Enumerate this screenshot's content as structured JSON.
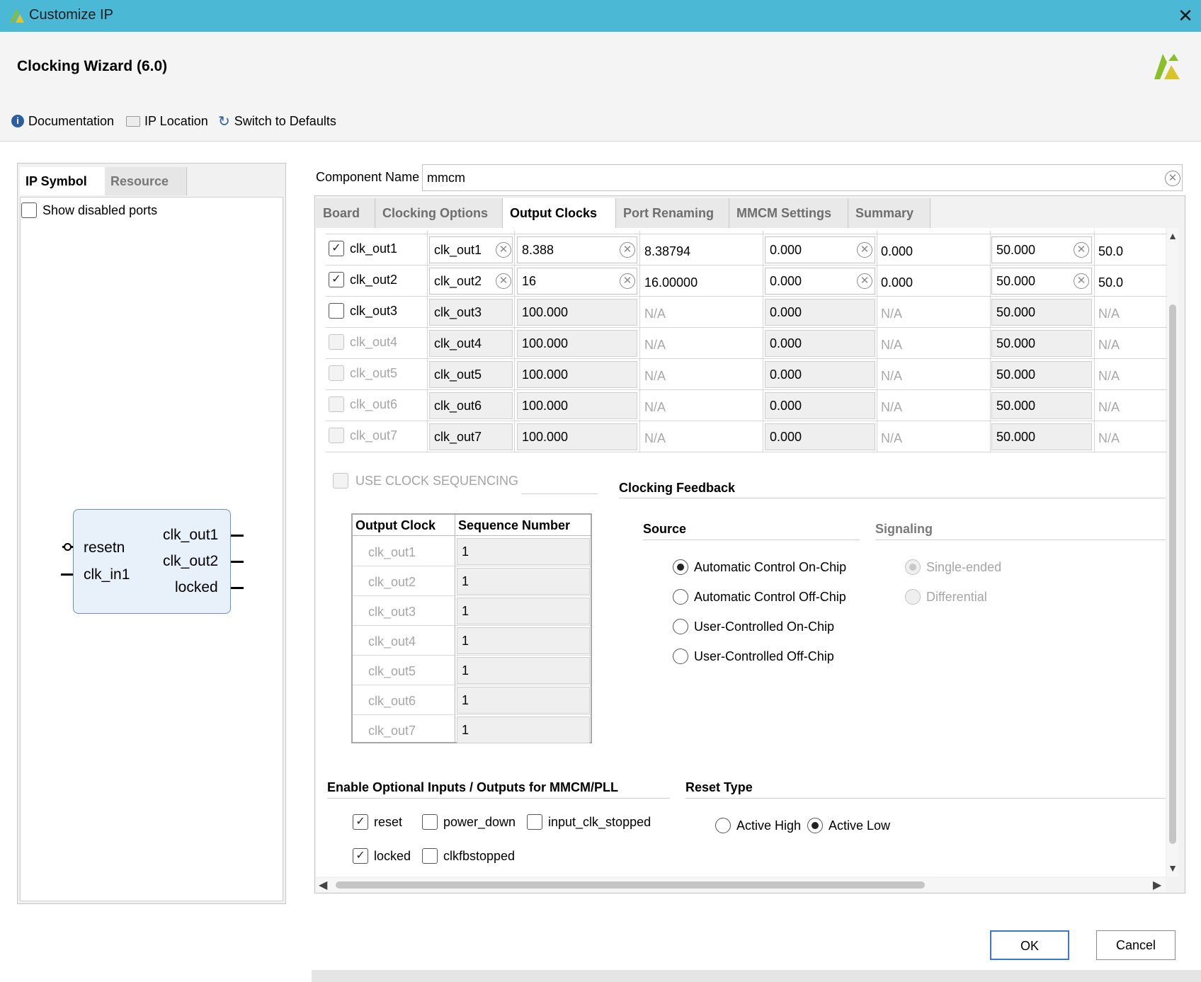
{
  "window": {
    "title": "Customize IP",
    "close_icon": "close-icon"
  },
  "header": {
    "wizard_title": "Clocking Wizard (6.0)",
    "toolbar": {
      "documentation": "Documentation",
      "ip_location": "IP Location",
      "switch_defaults": "Switch to Defaults"
    }
  },
  "left": {
    "tabs": [
      "IP Symbol",
      "Resource"
    ],
    "show_disabled_ports": "Show disabled ports",
    "symbol": {
      "inputs": [
        "resetn",
        "clk_in1"
      ],
      "outputs": [
        "clk_out1",
        "clk_out2",
        "locked"
      ]
    }
  },
  "component": {
    "label": "Component Name",
    "value": "mmcm"
  },
  "tabs": [
    "Board",
    "Clocking Options",
    "Output Clocks",
    "Port Renaming",
    "MMCM Settings",
    "Summary"
  ],
  "output_clocks": [
    {
      "enabled": true,
      "dim": false,
      "name": "clk_out1",
      "port": "clk_out1",
      "freq_req": "8.388",
      "freq_act": "8.38794",
      "phase_req": "0.000",
      "phase_act": "0.000",
      "duty_req": "50.000",
      "duty_act": "50.0"
    },
    {
      "enabled": true,
      "dim": false,
      "name": "clk_out2",
      "port": "clk_out2",
      "freq_req": "16",
      "freq_act": "16.00000",
      "phase_req": "0.000",
      "phase_act": "0.000",
      "duty_req": "50.000",
      "duty_act": "50.0"
    },
    {
      "enabled": false,
      "dim": false,
      "name": "clk_out3",
      "port": "clk_out3",
      "freq_req": "100.000",
      "freq_act": "N/A",
      "phase_req": "0.000",
      "phase_act": "N/A",
      "duty_req": "50.000",
      "duty_act": "N/A"
    },
    {
      "enabled": false,
      "dim": true,
      "name": "clk_out4",
      "port": "clk_out4",
      "freq_req": "100.000",
      "freq_act": "N/A",
      "phase_req": "0.000",
      "phase_act": "N/A",
      "duty_req": "50.000",
      "duty_act": "N/A"
    },
    {
      "enabled": false,
      "dim": true,
      "name": "clk_out5",
      "port": "clk_out5",
      "freq_req": "100.000",
      "freq_act": "N/A",
      "phase_req": "0.000",
      "phase_act": "N/A",
      "duty_req": "50.000",
      "duty_act": "N/A"
    },
    {
      "enabled": false,
      "dim": true,
      "name": "clk_out6",
      "port": "clk_out6",
      "freq_req": "100.000",
      "freq_act": "N/A",
      "phase_req": "0.000",
      "phase_act": "N/A",
      "duty_req": "50.000",
      "duty_act": "N/A"
    },
    {
      "enabled": false,
      "dim": true,
      "name": "clk_out7",
      "port": "clk_out7",
      "freq_req": "100.000",
      "freq_act": "N/A",
      "phase_req": "0.000",
      "phase_act": "N/A",
      "duty_req": "50.000",
      "duty_act": "N/A"
    }
  ],
  "sequencing": {
    "label": "USE CLOCK SEQUENCING",
    "headers": [
      "Output Clock",
      "Sequence Number"
    ],
    "rows": [
      {
        "clock": "clk_out1",
        "num": "1"
      },
      {
        "clock": "clk_out2",
        "num": "1"
      },
      {
        "clock": "clk_out3",
        "num": "1"
      },
      {
        "clock": "clk_out4",
        "num": "1"
      },
      {
        "clock": "clk_out5",
        "num": "1"
      },
      {
        "clock": "clk_out6",
        "num": "1"
      },
      {
        "clock": "clk_out7",
        "num": "1"
      }
    ]
  },
  "feedback": {
    "title": "Clocking Feedback",
    "source_title": "Source",
    "source_options": [
      "Automatic Control On-Chip",
      "Automatic Control Off-Chip",
      "User-Controlled On-Chip",
      "User-Controlled Off-Chip"
    ],
    "source_selected": "Automatic Control On-Chip",
    "signaling_title": "Signaling",
    "signaling_options": [
      "Single-ended",
      "Differential"
    ]
  },
  "optional_io": {
    "title": "Enable Optional Inputs / Outputs for MMCM/PLL",
    "items": [
      {
        "label": "reset",
        "checked": true
      },
      {
        "label": "power_down",
        "checked": false
      },
      {
        "label": "input_clk_stopped",
        "checked": false
      },
      {
        "label": "locked",
        "checked": true
      },
      {
        "label": "clkfbstopped",
        "checked": false
      }
    ]
  },
  "reset_type": {
    "title": "Reset Type",
    "options": [
      "Active High",
      "Active Low"
    ],
    "selected": "Active Low"
  },
  "buttons": {
    "ok": "OK",
    "cancel": "Cancel"
  },
  "colors": {
    "titlebar": "#4bb8d6",
    "accent": "#3c78c8"
  }
}
